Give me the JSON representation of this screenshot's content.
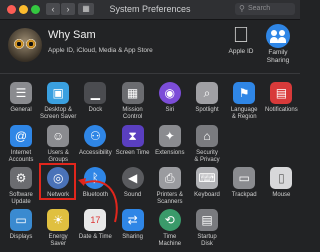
{
  "window": {
    "title": "System Preferences"
  },
  "search": {
    "placeholder": "Search"
  },
  "account": {
    "name": "Why Sam",
    "subtitle": "Apple ID, iCloud, Media & App Store",
    "apple_id_label": "Apple ID",
    "family_label_1": "Family",
    "family_label_2": "Sharing"
  },
  "rows": [
    [
      {
        "l1": "General",
        "l2": "",
        "icon": "general-icon",
        "color": "#8a8b8f"
      },
      {
        "l1": "Desktop &",
        "l2": "Screen Saver",
        "icon": "desktop-icon",
        "color": "#3aa0e0"
      },
      {
        "l1": "Dock",
        "l2": "",
        "icon": "dock-icon",
        "color": "#4b4c50"
      },
      {
        "l1": "Mission",
        "l2": "Control",
        "icon": "mission-control-icon",
        "color": "#6b6c70"
      },
      {
        "l1": "Siri",
        "l2": "",
        "icon": "siri-icon",
        "color": "#7c4dd8"
      },
      {
        "l1": "Spotlight",
        "l2": "",
        "icon": "spotlight-icon",
        "color": "#a0a0a4"
      },
      {
        "l1": "Language",
        "l2": "& Region",
        "icon": "language-icon",
        "color": "#2f86e6"
      },
      {
        "l1": "Notifications",
        "l2": "",
        "icon": "notifications-icon",
        "color": "#d83a3a"
      }
    ],
    [
      {
        "l1": "Internet",
        "l2": "Accounts",
        "icon": "at-icon",
        "color": "#2f86e6"
      },
      {
        "l1": "Users &",
        "l2": "Groups",
        "icon": "users-icon",
        "color": "#8a8b8f"
      },
      {
        "l1": "Accessibility",
        "l2": "",
        "icon": "accessibility-icon",
        "color": "#2f86e6"
      },
      {
        "l1": "Screen Time",
        "l2": "",
        "icon": "hourglass-icon",
        "color": "#5a3fc0"
      },
      {
        "l1": "Extensions",
        "l2": "",
        "icon": "puzzle-icon",
        "color": "#8a8b8f"
      },
      {
        "l1": "Security",
        "l2": "& Privacy",
        "icon": "house-icon",
        "color": "#7a7b7f"
      }
    ],
    [
      {
        "l1": "Software",
        "l2": "Update",
        "icon": "gear-icon",
        "color": "#6b6c70"
      },
      {
        "l1": "Network",
        "l2": "",
        "icon": "globe-icon",
        "color": "#4a72b8"
      },
      {
        "l1": "Bluetooth",
        "l2": "",
        "icon": "bluetooth-icon",
        "color": "#2f86e6"
      },
      {
        "l1": "Sound",
        "l2": "",
        "icon": "speaker-icon",
        "color": "#5a5b5f"
      },
      {
        "l1": "Printers &",
        "l2": "Scanners",
        "icon": "printer-icon",
        "color": "#9a9b9f"
      },
      {
        "l1": "Keyboard",
        "l2": "",
        "icon": "keyboard-icon",
        "color": "#b0b1b5"
      },
      {
        "l1": "Trackpad",
        "l2": "",
        "icon": "trackpad-icon",
        "color": "#8a8b8f"
      },
      {
        "l1": "Mouse",
        "l2": "",
        "icon": "mouse-icon",
        "color": "#d8d8da"
      }
    ],
    [
      {
        "l1": "Displays",
        "l2": "",
        "icon": "display-icon",
        "color": "#3a8ad0"
      },
      {
        "l1": "Energy",
        "l2": "Saver",
        "icon": "bulb-icon",
        "color": "#e0c040"
      },
      {
        "l1": "Date & Time",
        "l2": "",
        "icon": "calendar-icon",
        "color": "#e8e8e8"
      },
      {
        "l1": "Sharing",
        "l2": "",
        "icon": "sharing-icon",
        "color": "#2f86e6"
      },
      {
        "l1": "Time",
        "l2": "Machine",
        "icon": "time-machine-icon",
        "color": "#3a9a6a"
      },
      {
        "l1": "Startup",
        "l2": "Disk",
        "icon": "disk-icon",
        "color": "#7a7b7f"
      }
    ]
  ],
  "highlight_color": "#e1261c"
}
